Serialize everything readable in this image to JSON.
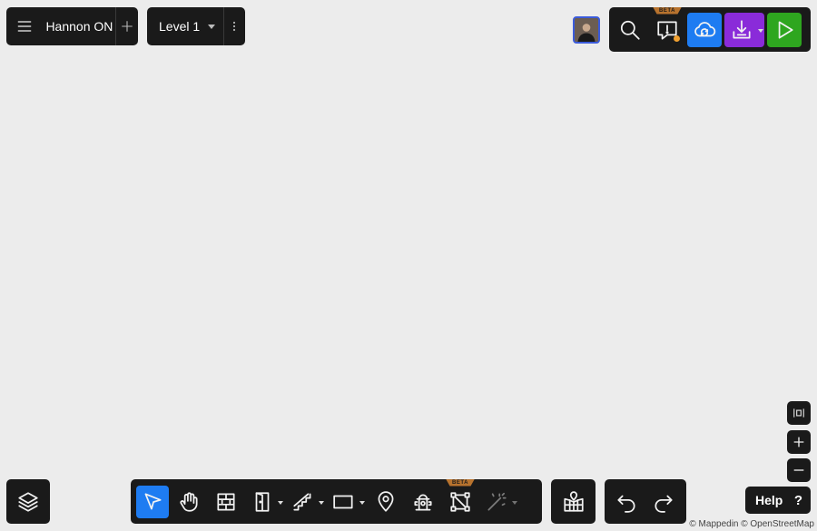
{
  "header": {
    "project_name": "Hannon ON",
    "level_label": "Level 1",
    "beta_label": "BETA"
  },
  "toolbar": {
    "beta_label": "BETA"
  },
  "help": {
    "label": "Help",
    "icon_glyph": "?"
  },
  "attribution": "© Mappedin © OpenStreetMap",
  "colors": {
    "panel": "#1a1a1a",
    "canvas": "#ececec",
    "publish_blue": "#1e7cf2",
    "export_purple": "#8a2bd9",
    "preview_green": "#2ea61f",
    "active_tool": "#1e7cf2",
    "beta_badge": "#b8732e",
    "notification_dot": "#f0a030"
  }
}
